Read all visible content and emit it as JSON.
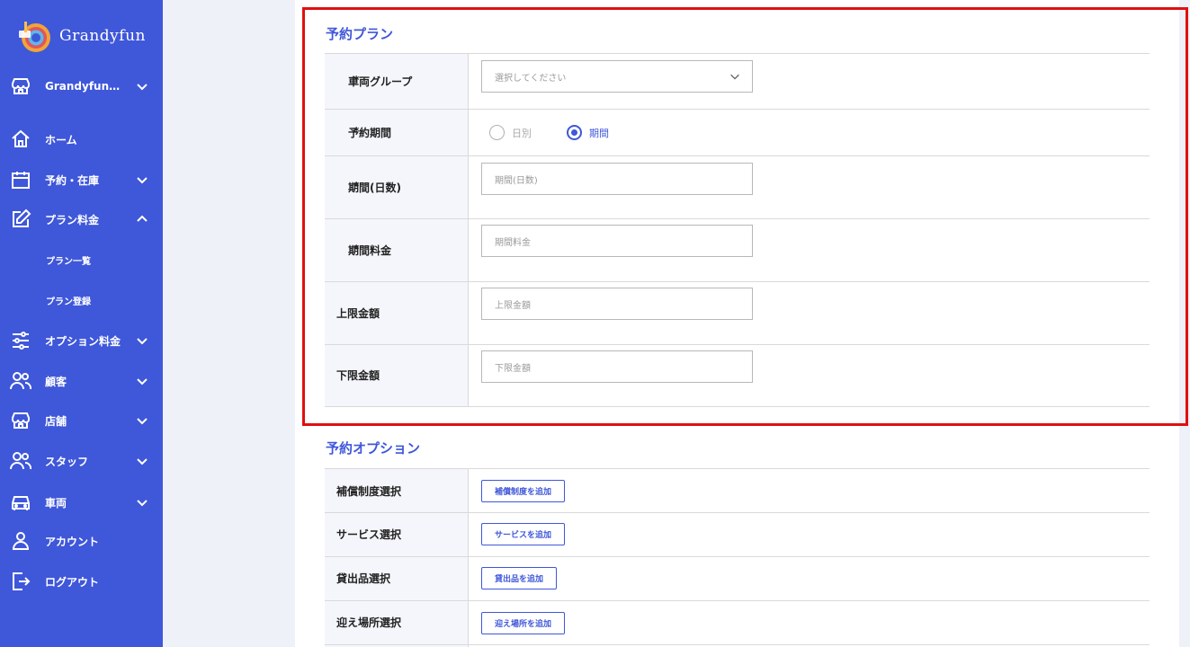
{
  "brand": {
    "name": "Grandyfun"
  },
  "sidebar": {
    "store_selector": "Grandyfun…",
    "items": [
      {
        "label": "ホーム"
      },
      {
        "label": "予約・在庫"
      },
      {
        "label": "プラン料金"
      },
      {
        "label": "オプション料金"
      },
      {
        "label": "顧客"
      },
      {
        "label": "店舗"
      },
      {
        "label": "スタッフ"
      },
      {
        "label": "車両"
      },
      {
        "label": "アカウント"
      },
      {
        "label": "ログアウト"
      }
    ],
    "sub_items": [
      {
        "label": "プラン一覧"
      },
      {
        "label": "プラン登録"
      }
    ]
  },
  "plan_section": {
    "title": "予約プラン",
    "vehicle_group": {
      "label": "車両グループ",
      "placeholder": "選択してください"
    },
    "period_type": {
      "label": "予約期間",
      "option_daily": "日別",
      "option_period": "期間",
      "selected": "期間"
    },
    "days": {
      "label": "期間(日数)",
      "placeholder": "期間(日数)"
    },
    "period_fee": {
      "label": "期間料金",
      "placeholder": "期間料金"
    },
    "upper_limit": {
      "label": "上限金額",
      "placeholder": "上限金額"
    },
    "lower_limit": {
      "label": "下限金額",
      "placeholder": "下限金額"
    },
    "required_mark": "*"
  },
  "option_section": {
    "title": "予約オプション",
    "rows": [
      {
        "label": "補償制度選択",
        "button": "補償制度を追加"
      },
      {
        "label": "サービス選択",
        "button": "サービスを追加"
      },
      {
        "label": "貸出品選択",
        "button": "貸出品を追加"
      },
      {
        "label": "迎え場所選択",
        "button": "迎え場所を追加"
      }
    ]
  },
  "colors": {
    "sidebar": "#3f57d9",
    "accent": "#3f57d9",
    "required": "#e02020",
    "highlight": "#e01010"
  }
}
